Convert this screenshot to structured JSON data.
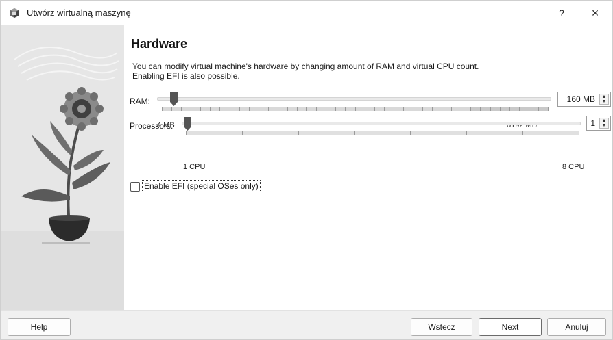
{
  "window": {
    "title": "Utwórz wirtualną maszynę",
    "help_glyph": "?",
    "close_glyph": "×"
  },
  "page": {
    "heading": "Hardware",
    "description_line1": "You can modify virtual machine's hardware by changing amount of RAM and virtual CPU count.",
    "description_line2": "Enabling EFI is also possible."
  },
  "ram": {
    "label": "RAM:",
    "value": 160,
    "display_value": "160 MB",
    "min_label": "4 MB",
    "max_label": "8192 MB",
    "min": 4,
    "max": 8192
  },
  "processors": {
    "label": "Processors:",
    "value": 1,
    "display_value": "1",
    "min_label": "1 CPU",
    "max_label": "8 CPU",
    "min": 1,
    "max": 8
  },
  "efi": {
    "label": "Enable EFI (special OSes only)",
    "checked": false
  },
  "buttons": {
    "help": "Help",
    "back": "Wstecz",
    "next": "Next",
    "cancel": "Anuluj"
  },
  "icons": {
    "app": "virtualbox-cube-icon",
    "spin_up": "spin-up-arrow-icon",
    "spin_down": "spin-down-arrow-icon",
    "slider": "slider-handle-icon"
  },
  "colors": {
    "handle": "#555555",
    "range_highlight": "#c9c9c9",
    "side_panel": "#e6e6e6"
  }
}
